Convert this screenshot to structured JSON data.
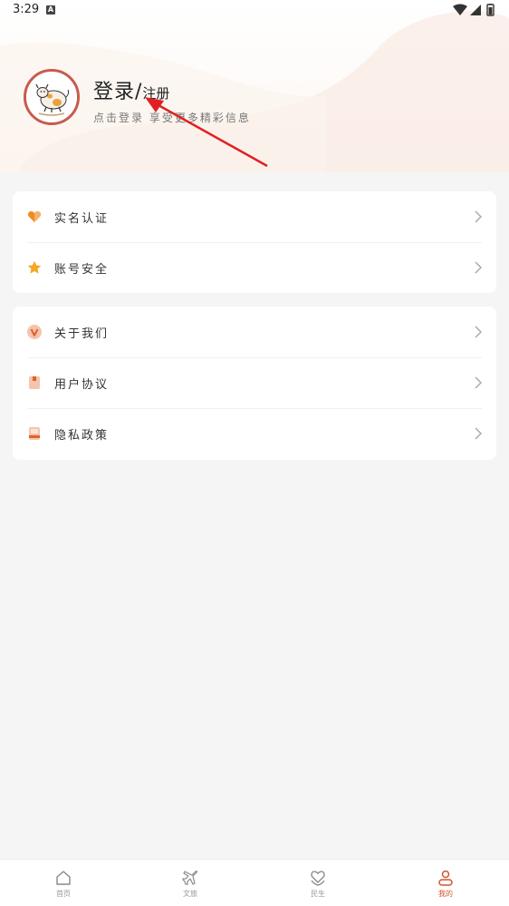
{
  "status_bar": {
    "time": "3:29",
    "notification_letter": "A"
  },
  "profile": {
    "login_main": "登录/",
    "login_sub": "注册",
    "hint": "点击登录 享受更多精彩信息"
  },
  "menu_group_1": [
    {
      "label": "实名认证",
      "icon": "heart-icon",
      "color": "#f08a24"
    },
    {
      "label": "账号安全",
      "icon": "star-icon",
      "color": "#f5a623"
    }
  ],
  "menu_group_2": [
    {
      "label": "关于我们",
      "icon": "v-badge-icon",
      "color": "#f0b59a"
    },
    {
      "label": "用户协议",
      "icon": "document-icon",
      "color": "#f0b59a"
    },
    {
      "label": "隐私政策",
      "icon": "book-icon",
      "color": "#f0b59a"
    }
  ],
  "bottom_nav": [
    {
      "label": "首页",
      "icon": "home-icon",
      "active": false
    },
    {
      "label": "文旅",
      "icon": "airplane-icon",
      "active": false
    },
    {
      "label": "民生",
      "icon": "heart-hands-icon",
      "active": false
    },
    {
      "label": "我的",
      "icon": "user-icon",
      "active": true
    }
  ],
  "colors": {
    "accent": "#d0562a",
    "avatar_border": "#c85a4e",
    "annotation_arrow": "#e02020",
    "background": "#f5f5f5"
  }
}
